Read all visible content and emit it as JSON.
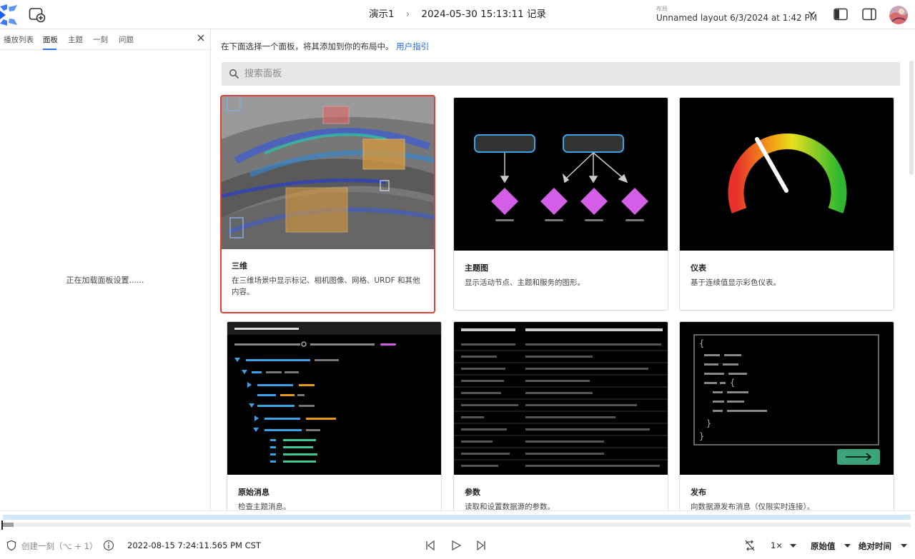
{
  "header": {
    "source_name": "演示1",
    "recording": "2024-05-30 15:13:11 记录",
    "layout_caption": "布局",
    "layout_name": "Unnamed layout 6/3/2024 at 1:42 PM"
  },
  "sidebar": {
    "tabs": [
      {
        "label": "播放列表"
      },
      {
        "label": "面板"
      },
      {
        "label": "主题"
      },
      {
        "label": "一刻"
      },
      {
        "label": "问题"
      }
    ],
    "loading_text": "正在加载面板设置......"
  },
  "main": {
    "intro_text": "在下面选择一个面板，将其添加到你的布局中。",
    "intro_link": "用户指引",
    "search_placeholder": "搜索面板",
    "cards": [
      {
        "title": "三维",
        "desc": "在三维场景中显示标记、相机图像、网格、URDF 和其他内容。"
      },
      {
        "title": "主题图",
        "desc": "显示活动节点、主题和服务的图形。"
      },
      {
        "title": "仪表",
        "desc": "基于连续值显示彩色仪表。"
      },
      {
        "title": "原始消息",
        "desc": "检查主题消息。"
      },
      {
        "title": "参数",
        "desc": "读取和设置数据源的参数。"
      },
      {
        "title": "发布",
        "desc": "向数据源发布消息（仅限实时连接）。"
      }
    ]
  },
  "playback": {
    "create_moment": "创建一刻（⌥ + 1）",
    "timestamp": "2022-08-15 7:24:11.565 PM CST",
    "speed": "1×",
    "value_mode": "原始值",
    "time_mode": "绝对时间",
    "progress_fraction": 0.0
  },
  "colors": {
    "accent": "#2f6fe8",
    "selection": "#e53d2f",
    "link": "#2368e3"
  }
}
